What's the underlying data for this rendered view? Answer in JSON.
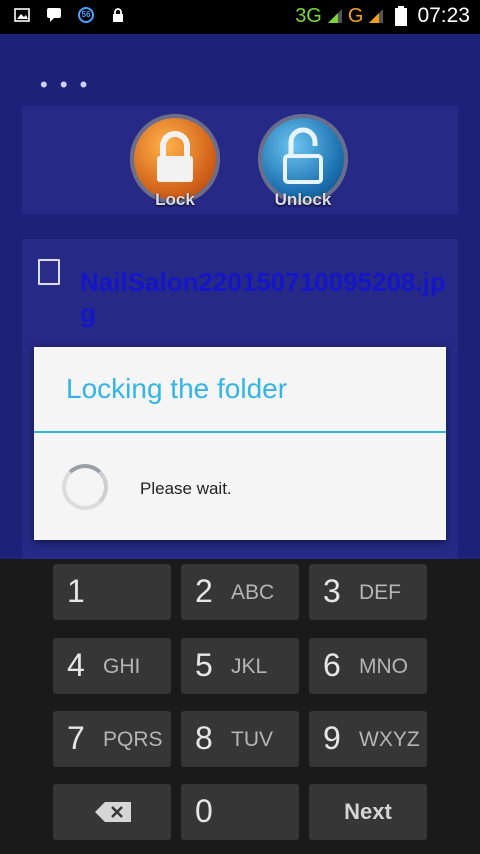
{
  "status_bar": {
    "left_icons": [
      "image-icon",
      "chat-icon",
      "badge-56-icon",
      "lock-icon"
    ],
    "badge_text": "56",
    "network_3g": "3G",
    "network_g": "G",
    "time": "07:23"
  },
  "app": {
    "menu_dots": "• • •",
    "lock_label": "Lock",
    "unlock_label": "Unlock",
    "file_name": "NailSalon220150710095208.jpg"
  },
  "dialog": {
    "title": "Locking the folder",
    "message": "Please wait."
  },
  "keypad": {
    "rows": [
      [
        {
          "num": "1",
          "letters": ""
        },
        {
          "num": "2",
          "letters": "ABC"
        },
        {
          "num": "3",
          "letters": "DEF"
        }
      ],
      [
        {
          "num": "4",
          "letters": "GHI"
        },
        {
          "num": "5",
          "letters": "JKL"
        },
        {
          "num": "6",
          "letters": "MNO"
        }
      ],
      [
        {
          "num": "7",
          "letters": "PQRS"
        },
        {
          "num": "8",
          "letters": "TUV"
        },
        {
          "num": "9",
          "letters": "WXYZ"
        }
      ]
    ],
    "zero": "0",
    "next_label": "Next"
  },
  "colors": {
    "app_background": "#1e2178",
    "dialog_accent": "#33b5e5",
    "file_name_color": "#1515c8"
  }
}
